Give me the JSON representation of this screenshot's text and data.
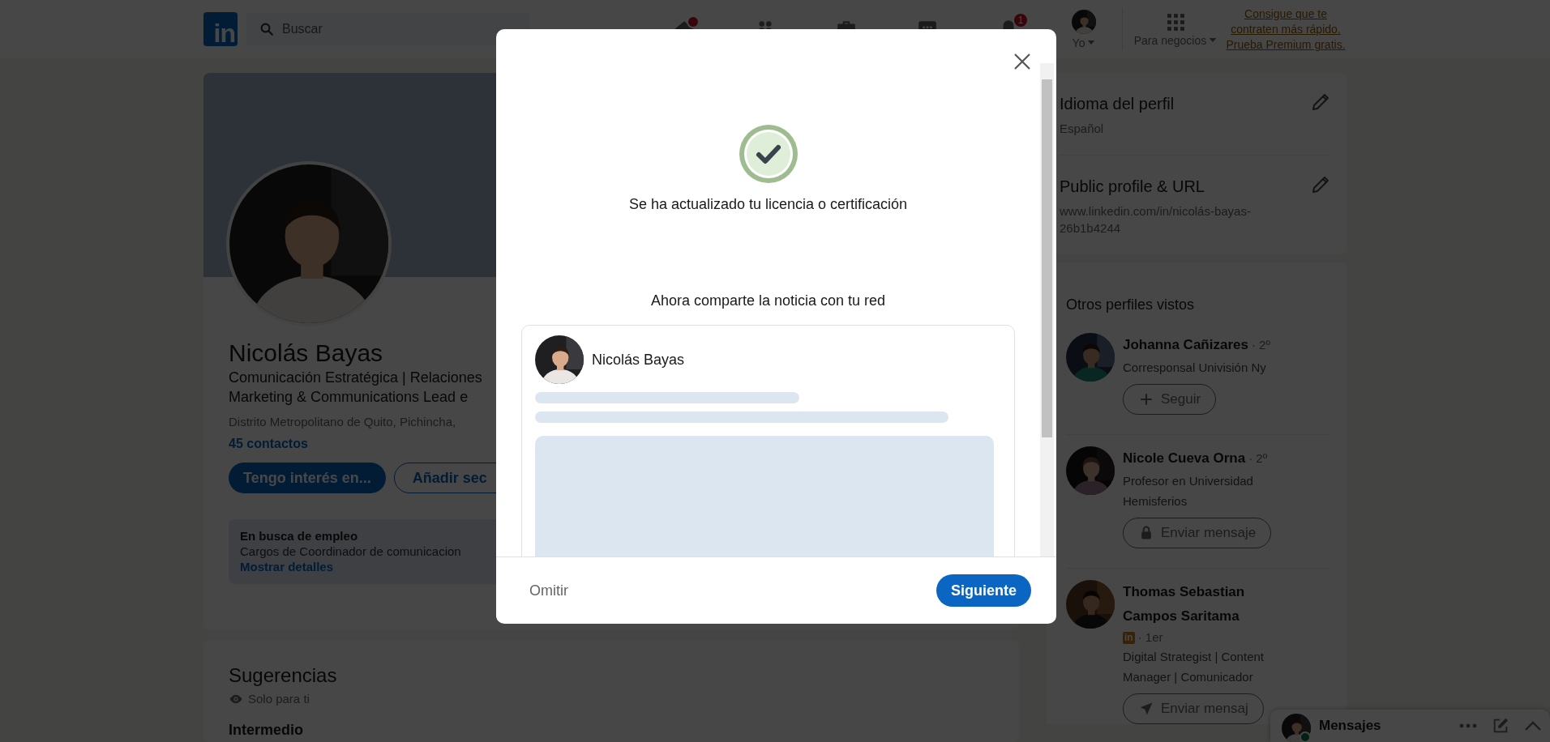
{
  "nav": {
    "logo": "in",
    "search": {
      "placeholder": "Buscar"
    },
    "items": [
      {
        "kind": "home",
        "badge_dot": true
      },
      {
        "kind": "network"
      },
      {
        "kind": "jobs"
      },
      {
        "kind": "messaging"
      },
      {
        "kind": "notifications",
        "badge": "1"
      },
      {
        "kind": "me",
        "label": "Yo"
      },
      {
        "kind": "business",
        "label": "Para negocios"
      }
    ],
    "premium_link": "Consigue que te contraten más rápido. Prueba Premium gratis."
  },
  "profile": {
    "name": "Nicolás Bayas",
    "headline_lines": [
      "Comunicación Estratégica | Relaciones",
      "Marketing & Communications Lead e"
    ],
    "location": "Distrito Metropolitano de Quito, Pichincha,",
    "connections": "45 contactos",
    "buttons": [
      {
        "label": "Tengo interés en...",
        "kind": "primary"
      },
      {
        "label": "Añadir sec",
        "kind": "secondary"
      }
    ],
    "job_box": {
      "title": "En busca de empleo",
      "text": "Cargos de Coordinador de comunicacion",
      "link": "Mostrar detalles"
    }
  },
  "suggestions": {
    "title": "Sugerencias",
    "note": "Solo para ti",
    "section": "Intermedio"
  },
  "sidebar": {
    "settings": [
      {
        "title": "Idioma del perfil",
        "lines": [
          "Español"
        ]
      },
      {
        "title": "Public profile & URL",
        "lines": [
          "www.linkedin.com/in/nicolás-bayas-",
          "26b1b4244"
        ]
      }
    ],
    "people": {
      "title": "Otros perfiles vistos",
      "items": [
        {
          "name": "Johanna Cañizares",
          "degree": "· 2º",
          "lines": [
            "Corresponsal Univisión Ny"
          ],
          "action": {
            "kind": "follow",
            "label": "Seguir"
          }
        },
        {
          "name": "Nicole Cueva Orna",
          "degree": "· 2º",
          "lines": [
            "Profesor en Universidad",
            "Hemisferios"
          ],
          "action": {
            "kind": "locked_message",
            "label": "Enviar mensaje"
          }
        },
        {
          "name": "Thomas Sebastian Campos Saritama",
          "badge": "in",
          "degree": "· 1er",
          "lines": [
            "Digital Strategist | Content",
            "Manager | Comunicador"
          ],
          "action": {
            "kind": "message",
            "label": "Enviar mensaj"
          }
        }
      ]
    }
  },
  "messaging": {
    "label": "Mensajes",
    "online": true
  },
  "modal": {
    "success_message": "Se ha actualizado tu licencia o certificación",
    "share_title": "Ahora comparte la noticia con tu red",
    "preview": {
      "author": "Nicolás Bayas"
    },
    "buttons": [
      {
        "label": "Omitir",
        "kind": "text"
      },
      {
        "label": "Siguiente",
        "kind": "primary"
      }
    ]
  }
}
